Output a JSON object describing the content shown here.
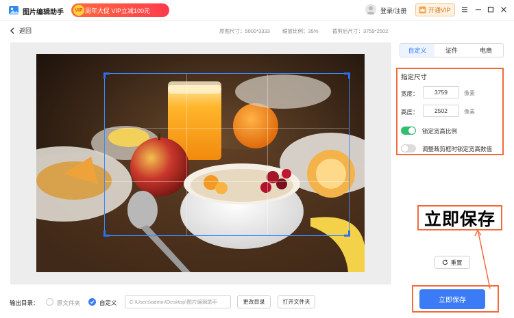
{
  "app": {
    "title": "图片编辑助手",
    "logo_icon": "image-icon"
  },
  "promo": {
    "badge": "VIP",
    "text": "周年大促 VIP立减100元"
  },
  "header": {
    "login": "登录/注册",
    "vip": "开通VIP"
  },
  "info": {
    "back": "返回",
    "original_size": "原图尺寸：5000*3333",
    "scale": "缩放比例：35%",
    "cropped_size": "截剪后尺寸：3759*2502"
  },
  "sidebar": {
    "tabs": [
      {
        "label": "自定义",
        "active": true
      },
      {
        "label": "证件",
        "active": false
      },
      {
        "label": "电商",
        "active": false
      }
    ],
    "panel": {
      "title": "指定尺寸",
      "width_label": "宽度：",
      "width_value": "3759",
      "height_label": "高度：",
      "height_value": "2502",
      "unit": "像素",
      "lock_ratio_label": "锁定宽高比例",
      "lock_ratio_on": true,
      "lock_values_label": "调整裁剪框时锁定宽高数值",
      "lock_values_on": false
    },
    "annotation": "立即保存",
    "reset": "重置",
    "save": "立即保存"
  },
  "footer": {
    "output_label": "输出目录：",
    "option_original": "原文件夹",
    "option_custom": "自定义",
    "selected": "custom",
    "path_value": "C:\\Users\\admin\\Desktop\\图片编辑助手",
    "change_dir": "更改目录",
    "open_folder": "打开文件夹"
  },
  "colors": {
    "accent": "#3b7bf6",
    "highlight": "#f26a3a",
    "toggle_on": "#2fbf71",
    "promo": "#ff4b45"
  }
}
